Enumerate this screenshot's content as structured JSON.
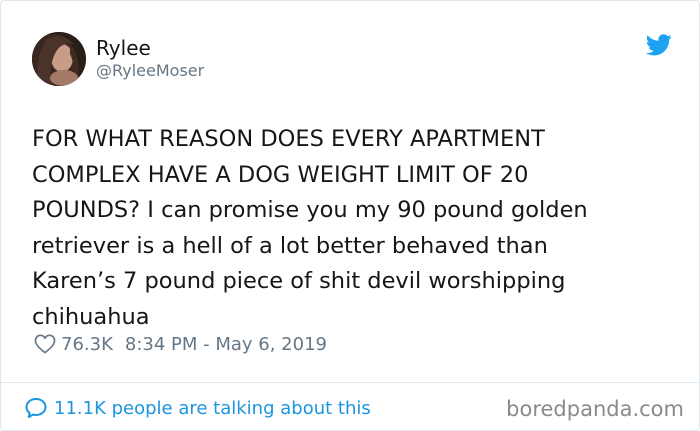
{
  "tweet": {
    "author": {
      "display_name": "Rylee",
      "handle": "@RyleeMoser",
      "avatar_icon": "profile-photo"
    },
    "platform_icon": "twitter-bird-icon",
    "text": "FOR WHAT REASON DOES EVERY APARTMENT\nCOMPLEX HAVE A DOG WEIGHT LIMIT OF 20\nPOUNDS? I can promise you my 90 pound golden\nretriever is a hell of a lot better behaved than\nKaren’s 7 pound piece of shit devil worshipping\nchihuahua",
    "likes": "76.3K",
    "timestamp": "8:34 PM - May 6, 2019",
    "conversation": "11.1K people are talking about this"
  },
  "watermark": "boredpanda.com",
  "colors": {
    "twitter_blue": "#1da1f2",
    "link_blue": "#1b95e0",
    "secondary_text": "#657786",
    "primary_text": "#14171a",
    "border": "#e1e8ed"
  }
}
